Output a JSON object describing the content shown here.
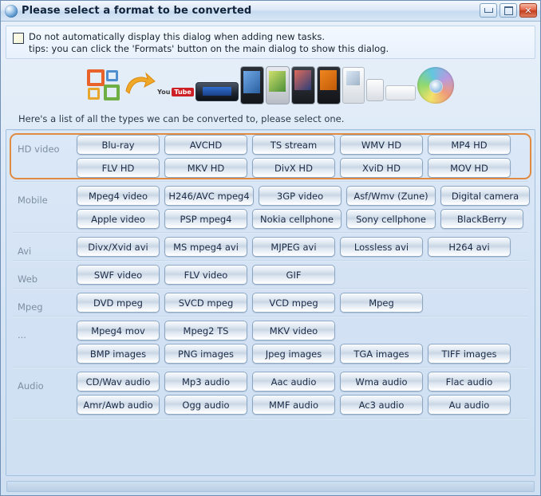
{
  "window": {
    "title": "Please select a format to be converted",
    "icon": "globe-icon",
    "buttons": {
      "minimize": "–",
      "maximize": "□",
      "close": "✕"
    }
  },
  "options": {
    "checkbox_label": "Do not automatically display this dialog when adding new tasks.",
    "tip": "tips: you can click the 'Formats' button on the main dialog to show this dialog.",
    "checked": false
  },
  "banner": {
    "youtube_word": "You",
    "youtube_badge": "Tube"
  },
  "hint": "Here's a list of all the types we can be converted to, please select one.",
  "highlight_color": "#e08a42",
  "sections": [
    {
      "label": "HD video",
      "highlighted": true,
      "rows": [
        [
          "Blu-ray",
          "AVCHD",
          "TS stream",
          "WMV HD",
          "MP4 HD"
        ],
        [
          "FLV HD",
          "MKV HD",
          "DivX HD",
          "XviD HD",
          "MOV HD"
        ]
      ]
    },
    {
      "label": "Mobile",
      "highlighted": false,
      "rows": [
        [
          "Mpeg4 video",
          "H246/AVC mpeg4",
          "3GP video",
          "Asf/Wmv (Zune)",
          "Digital camera"
        ],
        [
          "Apple video",
          "PSP mpeg4",
          "Nokia cellphone",
          "Sony cellphone",
          "BlackBerry"
        ]
      ]
    },
    {
      "label": "Avi",
      "highlighted": false,
      "rows": [
        [
          "Divx/Xvid avi",
          "MS mpeg4 avi",
          "MJPEG avi",
          "Lossless avi",
          "H264 avi"
        ]
      ]
    },
    {
      "label": "Web",
      "highlighted": false,
      "rows": [
        [
          "SWF video",
          "FLV video",
          "GIF"
        ]
      ]
    },
    {
      "label": "Mpeg",
      "highlighted": false,
      "rows": [
        [
          "DVD mpeg",
          "SVCD mpeg",
          "VCD mpeg",
          "Mpeg"
        ]
      ]
    },
    {
      "label": "...",
      "highlighted": false,
      "rows": [
        [
          "Mpeg4 mov",
          "Mpeg2 TS",
          "MKV video"
        ],
        [
          "BMP images",
          "PNG images",
          "Jpeg images",
          "TGA images",
          "TIFF images"
        ]
      ]
    },
    {
      "label": "Audio",
      "highlighted": false,
      "rows": [
        [
          "CD/Wav audio",
          "Mp3 audio",
          "Aac audio",
          "Wma audio",
          "Flac audio"
        ],
        [
          "Amr/Awb audio",
          "Ogg audio",
          "MMF audio",
          "Ac3 audio",
          "Au audio"
        ]
      ]
    }
  ]
}
